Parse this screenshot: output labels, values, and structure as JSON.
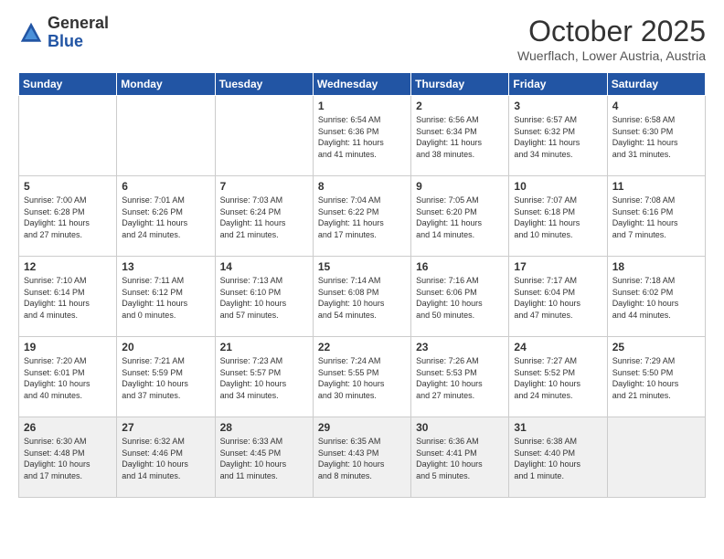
{
  "header": {
    "logo_general": "General",
    "logo_blue": "Blue",
    "title": "October 2025",
    "subtitle": "Wuerflach, Lower Austria, Austria"
  },
  "weekdays": [
    "Sunday",
    "Monday",
    "Tuesday",
    "Wednesday",
    "Thursday",
    "Friday",
    "Saturday"
  ],
  "weeks": [
    [
      {
        "day": "",
        "info": ""
      },
      {
        "day": "",
        "info": ""
      },
      {
        "day": "",
        "info": ""
      },
      {
        "day": "1",
        "info": "Sunrise: 6:54 AM\nSunset: 6:36 PM\nDaylight: 11 hours\nand 41 minutes."
      },
      {
        "day": "2",
        "info": "Sunrise: 6:56 AM\nSunset: 6:34 PM\nDaylight: 11 hours\nand 38 minutes."
      },
      {
        "day": "3",
        "info": "Sunrise: 6:57 AM\nSunset: 6:32 PM\nDaylight: 11 hours\nand 34 minutes."
      },
      {
        "day": "4",
        "info": "Sunrise: 6:58 AM\nSunset: 6:30 PM\nDaylight: 11 hours\nand 31 minutes."
      }
    ],
    [
      {
        "day": "5",
        "info": "Sunrise: 7:00 AM\nSunset: 6:28 PM\nDaylight: 11 hours\nand 27 minutes."
      },
      {
        "day": "6",
        "info": "Sunrise: 7:01 AM\nSunset: 6:26 PM\nDaylight: 11 hours\nand 24 minutes."
      },
      {
        "day": "7",
        "info": "Sunrise: 7:03 AM\nSunset: 6:24 PM\nDaylight: 11 hours\nand 21 minutes."
      },
      {
        "day": "8",
        "info": "Sunrise: 7:04 AM\nSunset: 6:22 PM\nDaylight: 11 hours\nand 17 minutes."
      },
      {
        "day": "9",
        "info": "Sunrise: 7:05 AM\nSunset: 6:20 PM\nDaylight: 11 hours\nand 14 minutes."
      },
      {
        "day": "10",
        "info": "Sunrise: 7:07 AM\nSunset: 6:18 PM\nDaylight: 11 hours\nand 10 minutes."
      },
      {
        "day": "11",
        "info": "Sunrise: 7:08 AM\nSunset: 6:16 PM\nDaylight: 11 hours\nand 7 minutes."
      }
    ],
    [
      {
        "day": "12",
        "info": "Sunrise: 7:10 AM\nSunset: 6:14 PM\nDaylight: 11 hours\nand 4 minutes."
      },
      {
        "day": "13",
        "info": "Sunrise: 7:11 AM\nSunset: 6:12 PM\nDaylight: 11 hours\nand 0 minutes."
      },
      {
        "day": "14",
        "info": "Sunrise: 7:13 AM\nSunset: 6:10 PM\nDaylight: 10 hours\nand 57 minutes."
      },
      {
        "day": "15",
        "info": "Sunrise: 7:14 AM\nSunset: 6:08 PM\nDaylight: 10 hours\nand 54 minutes."
      },
      {
        "day": "16",
        "info": "Sunrise: 7:16 AM\nSunset: 6:06 PM\nDaylight: 10 hours\nand 50 minutes."
      },
      {
        "day": "17",
        "info": "Sunrise: 7:17 AM\nSunset: 6:04 PM\nDaylight: 10 hours\nand 47 minutes."
      },
      {
        "day": "18",
        "info": "Sunrise: 7:18 AM\nSunset: 6:02 PM\nDaylight: 10 hours\nand 44 minutes."
      }
    ],
    [
      {
        "day": "19",
        "info": "Sunrise: 7:20 AM\nSunset: 6:01 PM\nDaylight: 10 hours\nand 40 minutes."
      },
      {
        "day": "20",
        "info": "Sunrise: 7:21 AM\nSunset: 5:59 PM\nDaylight: 10 hours\nand 37 minutes."
      },
      {
        "day": "21",
        "info": "Sunrise: 7:23 AM\nSunset: 5:57 PM\nDaylight: 10 hours\nand 34 minutes."
      },
      {
        "day": "22",
        "info": "Sunrise: 7:24 AM\nSunset: 5:55 PM\nDaylight: 10 hours\nand 30 minutes."
      },
      {
        "day": "23",
        "info": "Sunrise: 7:26 AM\nSunset: 5:53 PM\nDaylight: 10 hours\nand 27 minutes."
      },
      {
        "day": "24",
        "info": "Sunrise: 7:27 AM\nSunset: 5:52 PM\nDaylight: 10 hours\nand 24 minutes."
      },
      {
        "day": "25",
        "info": "Sunrise: 7:29 AM\nSunset: 5:50 PM\nDaylight: 10 hours\nand 21 minutes."
      }
    ],
    [
      {
        "day": "26",
        "info": "Sunrise: 6:30 AM\nSunset: 4:48 PM\nDaylight: 10 hours\nand 17 minutes."
      },
      {
        "day": "27",
        "info": "Sunrise: 6:32 AM\nSunset: 4:46 PM\nDaylight: 10 hours\nand 14 minutes."
      },
      {
        "day": "28",
        "info": "Sunrise: 6:33 AM\nSunset: 4:45 PM\nDaylight: 10 hours\nand 11 minutes."
      },
      {
        "day": "29",
        "info": "Sunrise: 6:35 AM\nSunset: 4:43 PM\nDaylight: 10 hours\nand 8 minutes."
      },
      {
        "day": "30",
        "info": "Sunrise: 6:36 AM\nSunset: 4:41 PM\nDaylight: 10 hours\nand 5 minutes."
      },
      {
        "day": "31",
        "info": "Sunrise: 6:38 AM\nSunset: 4:40 PM\nDaylight: 10 hours\nand 1 minute."
      },
      {
        "day": "",
        "info": ""
      }
    ]
  ]
}
